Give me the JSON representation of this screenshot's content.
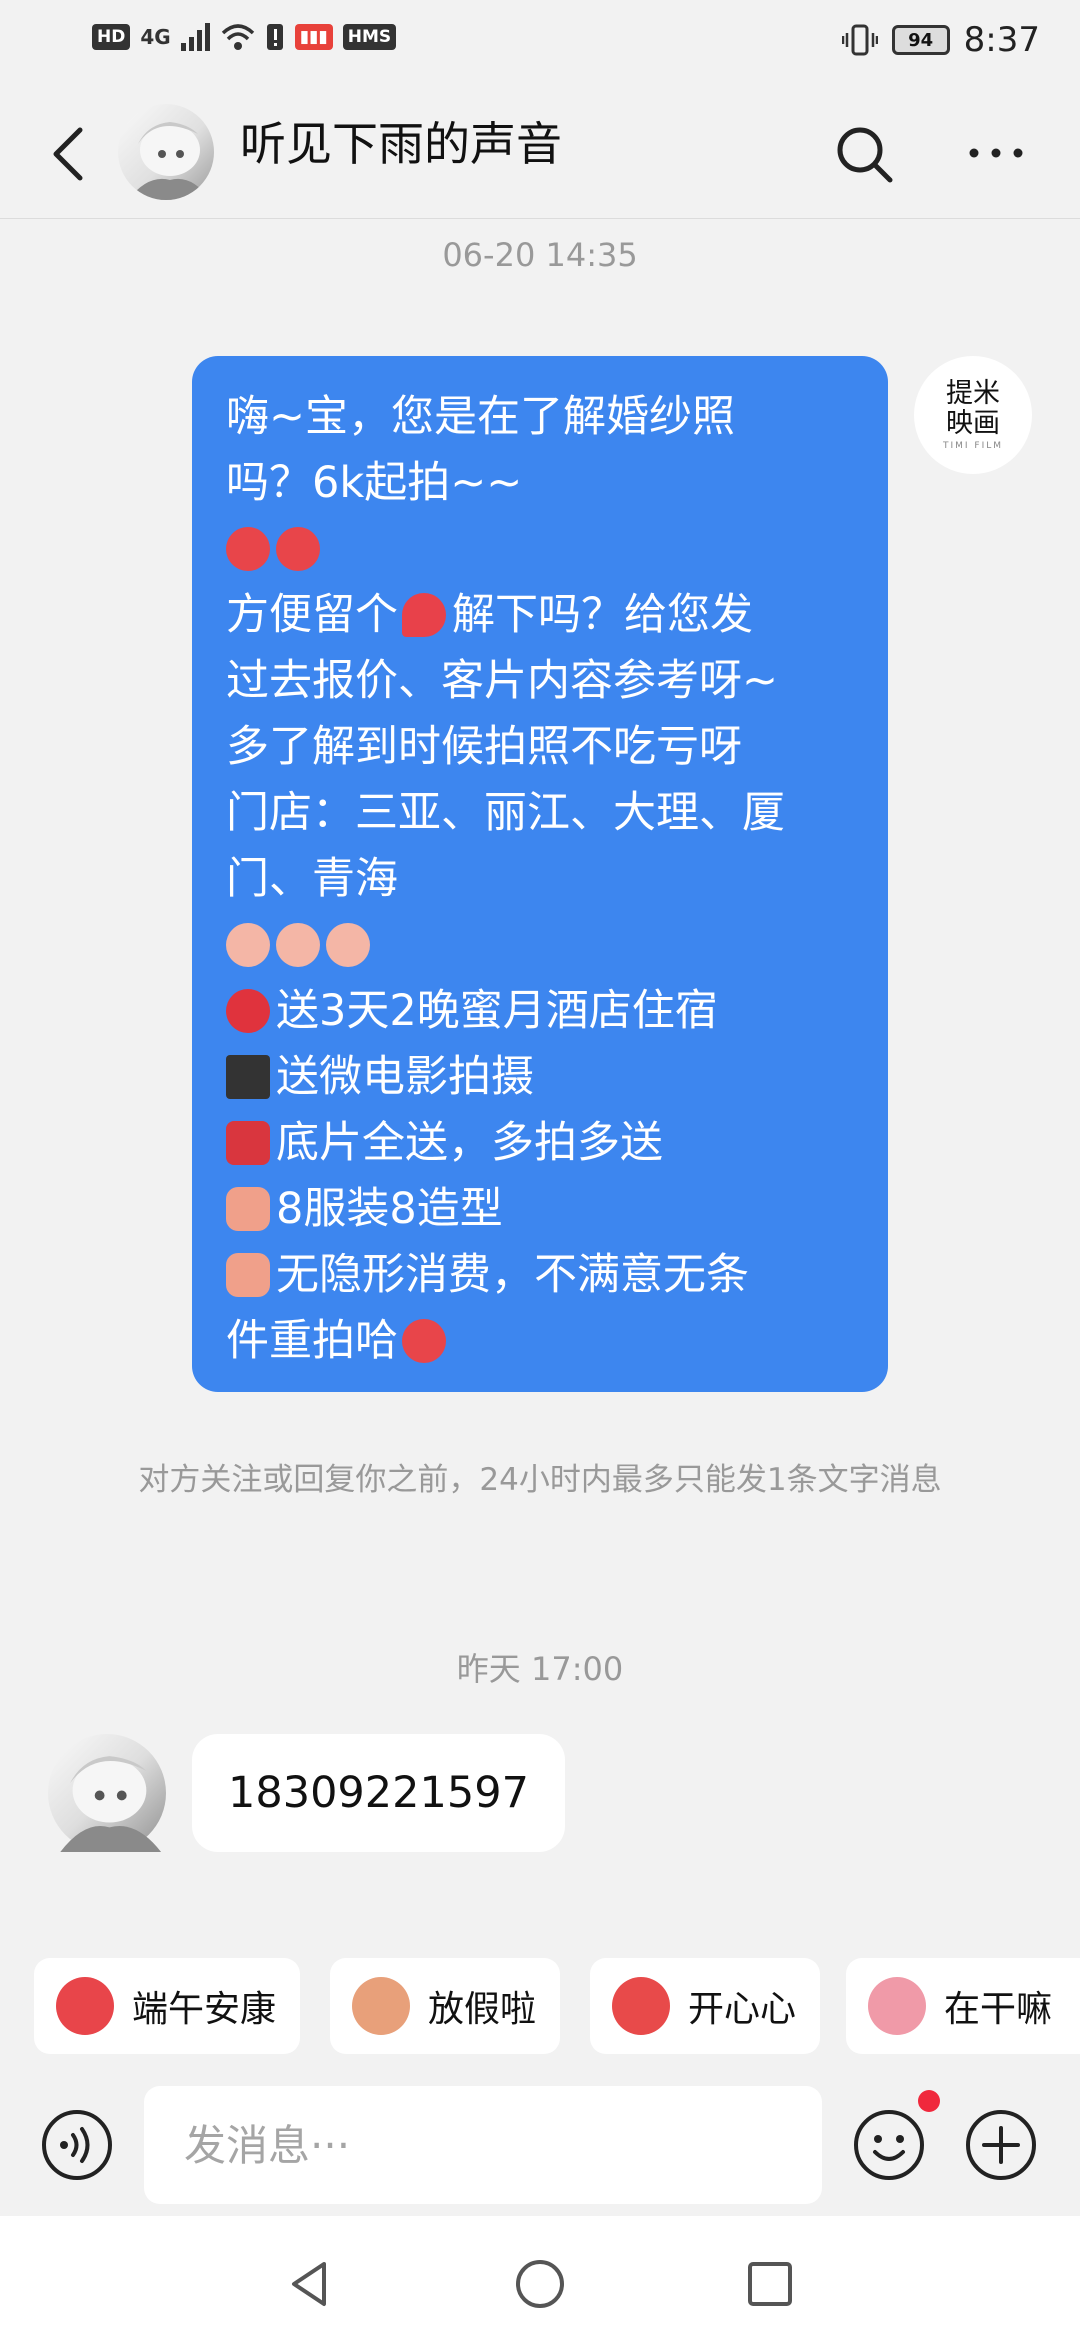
{
  "status_bar": {
    "left_badges": [
      "HD",
      "4G"
    ],
    "red_badge": "HMS",
    "battery": "94",
    "time": "8:37"
  },
  "header": {
    "title": "听见下雨的声音"
  },
  "chat": {
    "timestamp_1": "06-20 14:35",
    "shop_logo_line1": "提米",
    "shop_logo_line2": "映画",
    "shop_logo_sub": "TIMI FILM",
    "message_lines": [
      "嗨~宝，您是在了解婚纱照",
      "吗？6k起拍~~",
      "方便留个",
      "解下吗？给您发",
      "过去报价、客片内容参考呀~",
      "多了解到时候拍照不吃亏呀",
      "门店：三亚、丽江、大理、厦",
      "门、青海",
      "送3天2晚蜜月酒店住宿",
      "送微电影拍摄",
      "底片全送，多拍多送",
      "8服装8造型",
      "无隐形消费，不满意无条",
      "件重拍哈"
    ],
    "system_note": "对方关注或回复你之前，24小时内最多只能发1条文字消息",
    "timestamp_2": "昨天 17:00",
    "reply_text": "18309221597"
  },
  "stickers": [
    {
      "label": "端午安康",
      "color": "#e8454a"
    },
    {
      "label": "放假啦",
      "color": "#e8a07a"
    },
    {
      "label": "开心心",
      "color": "#e84a4a"
    },
    {
      "label": "在干嘛",
      "color": "#f09aa8"
    }
  ],
  "input": {
    "placeholder": "发消息···"
  },
  "colors": {
    "bubble_blue": "#3d86ef",
    "notification_dot": "#f0283c"
  }
}
